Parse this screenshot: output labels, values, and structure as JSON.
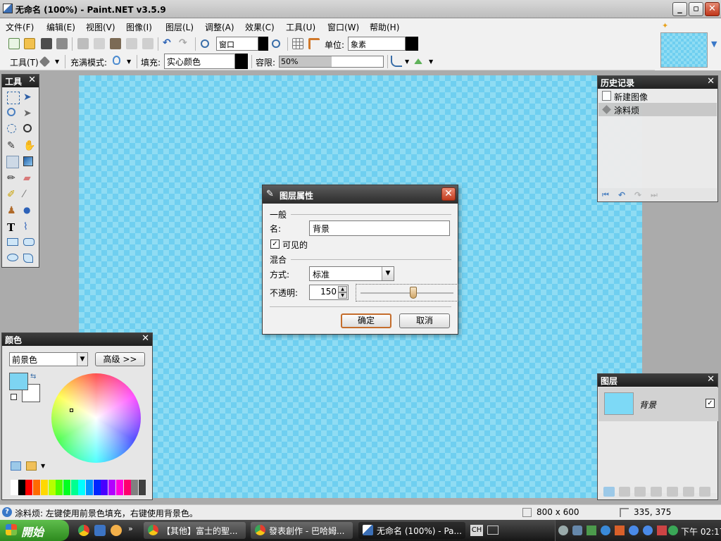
{
  "window": {
    "title": "无命名 (100%) - Paint.NET v3.5.9",
    "min_label": "_",
    "max_label": "▫",
    "close_label": "✕"
  },
  "menu": [
    {
      "label": "文件(F)"
    },
    {
      "label": "编辑(E)"
    },
    {
      "label": "视图(V)"
    },
    {
      "label": "图像(I)"
    },
    {
      "label": "图层(L)"
    },
    {
      "label": "调整(A)"
    },
    {
      "label": "效果(C)"
    },
    {
      "label": "工具(U)"
    },
    {
      "label": "窗口(W)"
    },
    {
      "label": "帮助(H)"
    }
  ],
  "toolbar": {
    "zoom_value": "窗口",
    "unit_label": "单位:",
    "unit_value": "象素",
    "tool_label": "工具(T)",
    "fill_mode_label": "充满模式:",
    "fill_label": "填充:",
    "fill_value": "实心颜色",
    "tolerance_label": "容限:",
    "tolerance_value": "50%",
    "tolerance_fraction": 0.5
  },
  "tools_panel": {
    "title": "工具",
    "close": "✕"
  },
  "history_panel": {
    "title": "历史记录",
    "close": "✕",
    "items": [
      {
        "label": "新建图像"
      },
      {
        "label": "涂料烦"
      }
    ]
  },
  "layers_panel": {
    "title": "图层",
    "close": "✕",
    "layer_name": "背景"
  },
  "colors_panel": {
    "title": "颜色",
    "close": "✕",
    "mode_value": "前景色",
    "advanced_label": "高级 >>",
    "primary_color": "#7dd4f2",
    "secondary_color": "#ffffff",
    "palette": [
      "#ffffff",
      "#000000",
      "#ff0000",
      "#ff6a00",
      "#ffd800",
      "#b6ff00",
      "#4cff00",
      "#00ff21",
      "#00ff90",
      "#00ffff",
      "#0094ff",
      "#0026ff",
      "#4800ff",
      "#b200ff",
      "#ff00dc",
      "#ff006e",
      "#808080",
      "#404040"
    ]
  },
  "dialog": {
    "title": "图层属性",
    "close": "✕",
    "section_general": "一般",
    "name_label": "名:",
    "name_value": "背景",
    "visible_label": "可见的",
    "visible_checked": true,
    "section_blend": "混合",
    "mode_label": "方式:",
    "mode_value": "标准",
    "opacity_label": "不透明:",
    "opacity_value": "150",
    "opacity_fraction": 0.588,
    "ok_label": "确定",
    "cancel_label": "取消"
  },
  "statusbar": {
    "message": "涂料烦: 左键使用前景色填充，右键使用背景色。",
    "image_size": "800 x 600",
    "cursor_pos": "335, 375"
  },
  "taskbar": {
    "start_label": "開始",
    "tasks": [
      {
        "label": "【其他】富士的聖..."
      },
      {
        "label": "發表創作 - 巴哈姆..."
      },
      {
        "label": "无命名 (100%) - Pa..."
      }
    ],
    "lang": "CH",
    "clock": "下午 02:17"
  },
  "colors": {
    "canvas_light": "#8fdcf3",
    "canvas_dark": "#6fcff0",
    "accent_close": "#c23b1d"
  }
}
